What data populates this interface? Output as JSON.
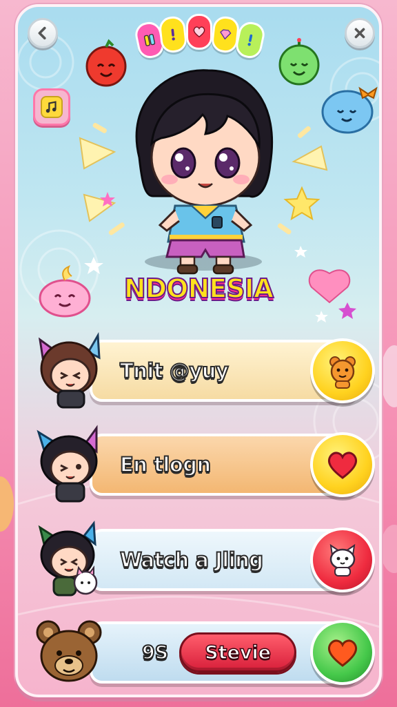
{
  "header": {
    "back_icon": "chevron-left-icon",
    "close_icon": "close-icon",
    "music_icon": "music-note-icon"
  },
  "top_badges": [
    {
      "icon": "gem-icon",
      "color": "#ff5bb3"
    },
    {
      "icon": "exclamation-icon",
      "color": "#ffe11d"
    },
    {
      "icon": "heart-icon",
      "color": "#ff4058"
    },
    {
      "icon": "gem-icon",
      "color": "#ffe11d"
    },
    {
      "icon": "exclamation-icon",
      "color": "#b8f05a"
    }
  ],
  "title": "NDONESIA",
  "menu": [
    {
      "label": "Tnit @yuy",
      "bar_color": "#fbe6b8",
      "icon": "bear-icon",
      "icon_color": "#ffd21f"
    },
    {
      "label": "En tlogn",
      "bar_color": "#f8c58d",
      "icon": "heart-icon",
      "icon_color": "#ffd21f"
    },
    {
      "label": "Watch a Jling",
      "bar_color": "#e3f0f8",
      "icon": "cat-icon",
      "icon_color": "#ef2b3f"
    }
  ],
  "footer_row": {
    "count": "9S",
    "name_button": "Stevie",
    "icon": "heart-icon",
    "icon_color": "#45c84a"
  },
  "colors": {
    "panel_top": "#a9dcef",
    "panel_bottom": "#f6b4cd",
    "title_fill": "#ffe11d",
    "title_outline": "#6a1a8a",
    "accent_pink": "#ff5bb3"
  }
}
